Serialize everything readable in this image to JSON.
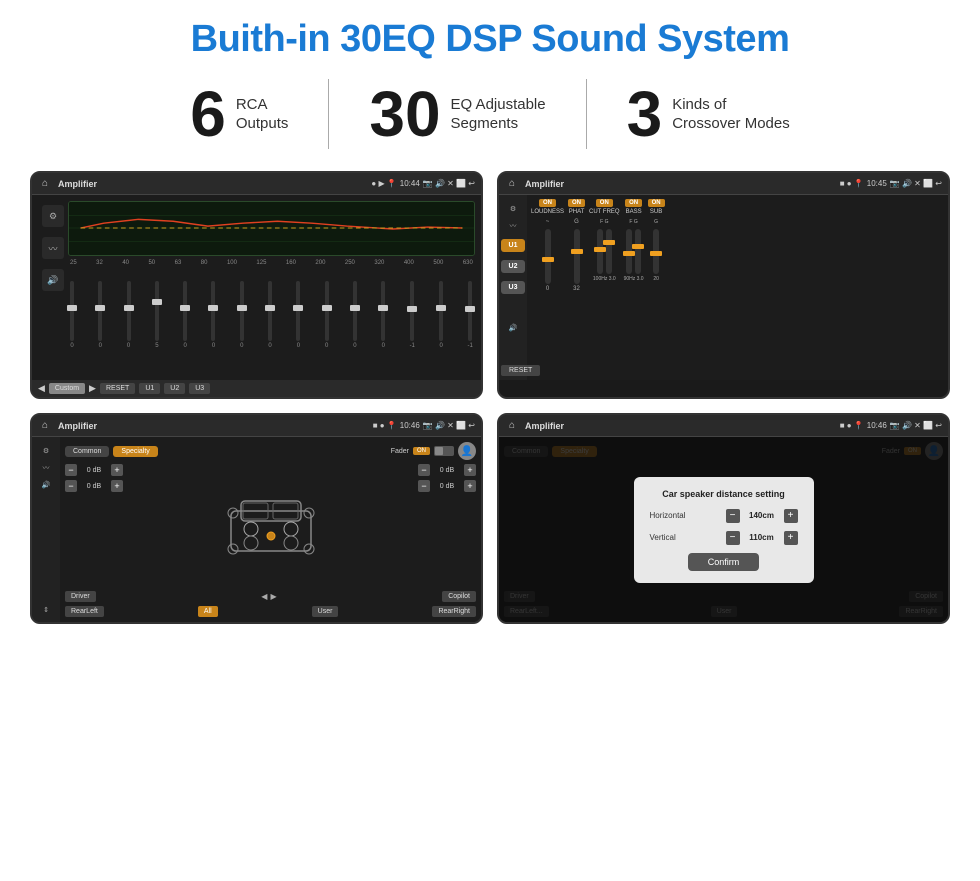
{
  "header": {
    "title": "Buith-in 30EQ DSP Sound System"
  },
  "stats": [
    {
      "number": "6",
      "line1": "RCA",
      "line2": "Outputs"
    },
    {
      "number": "30",
      "line1": "EQ Adjustable",
      "line2": "Segments"
    },
    {
      "number": "3",
      "line1": "Kinds of",
      "line2": "Crossover Modes"
    }
  ],
  "screens": [
    {
      "id": "screen1",
      "status_bar": {
        "app": "Amplifier",
        "time": "10:44"
      },
      "type": "eq",
      "preset": "Custom",
      "freqs": [
        "25",
        "32",
        "40",
        "50",
        "63",
        "80",
        "100",
        "125",
        "160",
        "200",
        "250",
        "320",
        "400",
        "500",
        "630"
      ],
      "values": [
        "0",
        "0",
        "0",
        "5",
        "0",
        "0",
        "0",
        "0",
        "0",
        "0",
        "0",
        "0",
        "-1",
        "0",
        "-1"
      ],
      "buttons": [
        "Custom",
        "RESET",
        "U1",
        "U2",
        "U3"
      ]
    },
    {
      "id": "screen2",
      "status_bar": {
        "app": "Amplifier",
        "time": "10:45"
      },
      "type": "crossover",
      "u_buttons": [
        "U1",
        "U2",
        "U3"
      ],
      "columns": [
        {
          "label": "LOUDNESS",
          "on": true
        },
        {
          "label": "PHAT",
          "on": true
        },
        {
          "label": "CUT FREQ",
          "on": true
        },
        {
          "label": "BASS",
          "on": true
        },
        {
          "label": "SUB",
          "on": true
        }
      ]
    },
    {
      "id": "screen3",
      "status_bar": {
        "app": "Amplifier",
        "time": "10:46"
      },
      "type": "speaker",
      "tabs": [
        "Common",
        "Specialty"
      ],
      "active_tab": "Specialty",
      "fader_label": "Fader",
      "fader_on": true,
      "volumes": [
        "0 dB",
        "0 dB",
        "0 dB",
        "0 dB"
      ],
      "buttons": [
        "Driver",
        "Copilot",
        "RearLeft",
        "All",
        "User",
        "RearRight"
      ]
    },
    {
      "id": "screen4",
      "status_bar": {
        "app": "Amplifier",
        "time": "10:46"
      },
      "type": "dialog",
      "dialog": {
        "title": "Car speaker distance setting",
        "horizontal_label": "Horizontal",
        "horizontal_value": "140cm",
        "vertical_label": "Vertical",
        "vertical_value": "110cm",
        "confirm_label": "Confirm"
      }
    }
  ]
}
